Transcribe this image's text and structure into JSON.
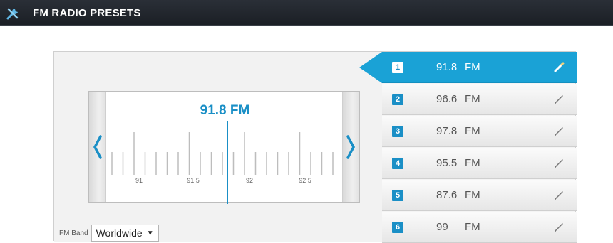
{
  "header": {
    "title": "FM RADIO PRESETS",
    "icon": "tools-icon"
  },
  "tuner": {
    "current_frequency": "91.8 FM",
    "tick_labels": [
      "91",
      "91.5",
      "92",
      "92.5"
    ],
    "left_arrow": "chevron-left-icon",
    "right_arrow": "chevron-right-icon"
  },
  "band": {
    "label": "FM Band",
    "value": "Worldwide"
  },
  "presets": [
    {
      "number": "1",
      "frequency": "91.8",
      "unit": "FM",
      "active": true
    },
    {
      "number": "2",
      "frequency": "96.6",
      "unit": "FM",
      "active": false
    },
    {
      "number": "3",
      "frequency": "97.8",
      "unit": "FM",
      "active": false
    },
    {
      "number": "4",
      "frequency": "95.5",
      "unit": "FM",
      "active": false
    },
    {
      "number": "5",
      "frequency": "87.6",
      "unit": "FM",
      "active": false
    },
    {
      "number": "6",
      "frequency": "99",
      "unit": "FM",
      "active": false
    }
  ],
  "colors": {
    "accent": "#1a8fc6",
    "active_row": "#1aa2d6",
    "header_bg": "#1f232a"
  }
}
